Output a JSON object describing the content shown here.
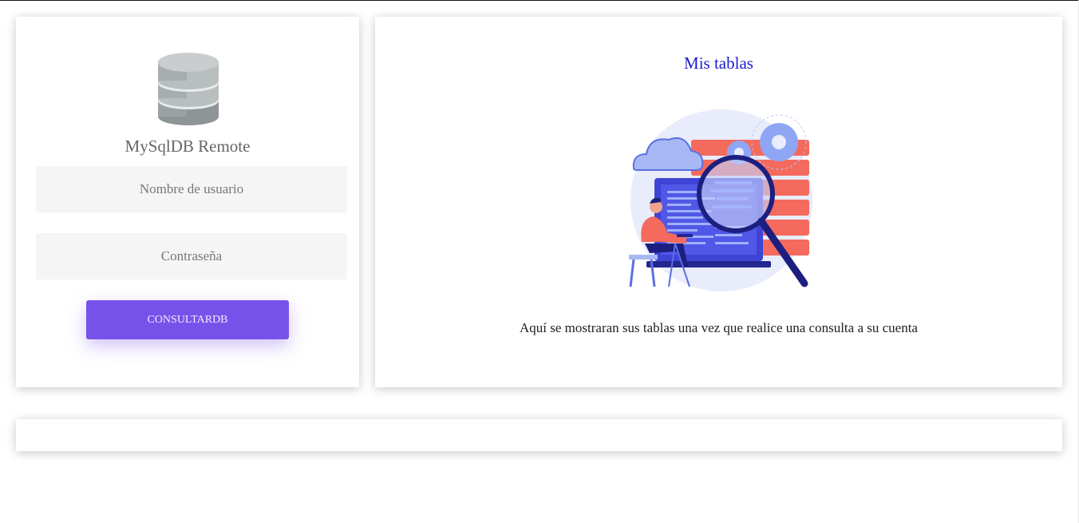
{
  "login": {
    "app_title": "MySqlDB Remote",
    "username_placeholder": "Nombre de usuario",
    "password_placeholder": "Contraseña",
    "submit_label": "CONSULTARDB",
    "icon": "database-icon"
  },
  "tables": {
    "title": "Mis tablas",
    "message": "Aquí se mostraran sus tablas una vez que realice una consulta a su cuenta",
    "illustration": "data-search-illustration"
  },
  "colors": {
    "accent": "#7752ea",
    "title_blue": "#1c1ccf",
    "field_bg": "#f5f5f5"
  }
}
